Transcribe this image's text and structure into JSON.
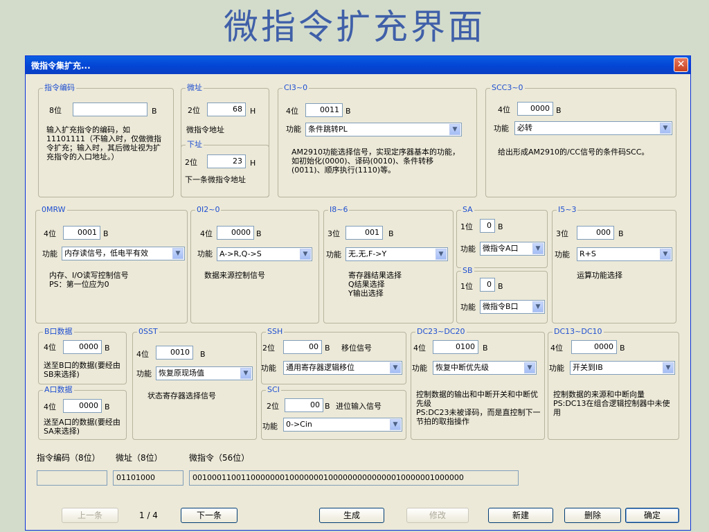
{
  "slide_title": "微指令扩充界面",
  "window": {
    "title": "微指令集扩充...",
    "close_glyph": "✕"
  },
  "groups": {
    "code": {
      "label": "指令编码",
      "prefix": "8位",
      "value": "",
      "unit": "B",
      "desc": "输入扩充指令的编码，如11101111（不输入时，仅做微指令扩充；输入时，其后微址视为扩充指令的入口地址。）"
    },
    "addr": {
      "label": "微址",
      "prefix": "2位",
      "value": "68",
      "unit": "H",
      "desc": "微指令地址"
    },
    "next": {
      "label": "下址",
      "prefix": "2位",
      "value": "23",
      "unit": "H",
      "desc": "下一条微指令地址"
    },
    "ci": {
      "label": "CI3~0",
      "prefix": "4位",
      "value": "0011",
      "unit": "B",
      "func_label": "功能",
      "func_value": "条件跳转PL",
      "desc": "AM2910功能选择信号，实现定序器基本的功能，如初始化(0000)、译码(0010)、条件转移(0011)、顺序执行(1110)等。"
    },
    "scc": {
      "label": "SCC3~0",
      "prefix": "4位",
      "value": "0000",
      "unit": "B",
      "func_label": "功能",
      "func_value": "必转",
      "desc": "给出形成AM2910的/CC信号的条件码SCC。"
    },
    "omrw": {
      "label": "0MRW",
      "prefix": "4位",
      "value": "0001",
      "unit": "B",
      "func_label": "功能",
      "func_value": "内存读信号，低电平有效",
      "desc": "内存、I/O读写控制信号\nPS：第一位应为0"
    },
    "oi2": {
      "label": "0I2~0",
      "prefix": "4位",
      "value": "0000",
      "unit": "B",
      "func_label": "功能",
      "func_value": "A->R,Q->S",
      "desc": "数据来源控制信号"
    },
    "i8": {
      "label": "I8~6",
      "prefix": "3位",
      "value": "001",
      "unit": "B",
      "func_label": "功能",
      "func_value": "无,无,F->Y",
      "desc": "寄存器结果选择\nQ结果选择\nY输出选择"
    },
    "sa": {
      "label": "SA",
      "prefix": "1位",
      "value": "0",
      "unit": "B",
      "func_label": "功能",
      "func_value": "微指令A口"
    },
    "sb": {
      "label": "SB",
      "prefix": "1位",
      "value": "0",
      "unit": "B",
      "func_label": "功能",
      "func_value": "微指令B口"
    },
    "i5": {
      "label": "I5~3",
      "prefix": "3位",
      "value": "000",
      "unit": "B",
      "func_label": "功能",
      "func_value": "R+S",
      "desc": "运算功能选择"
    },
    "bport": {
      "label": "B口数据",
      "prefix": "4位",
      "value": "0000",
      "unit": "B",
      "desc": "送至B口的数据(要经由SB来选择)"
    },
    "aport": {
      "label": "A口数据",
      "prefix": "4位",
      "value": "0000",
      "unit": "B",
      "desc": "送至A口的数据(要经由SA来选择)"
    },
    "osst": {
      "label": "0SST",
      "prefix": "4位",
      "value": "0010",
      "unit": "B",
      "func_label": "功能",
      "func_value": "恢复原现场值",
      "desc": "状态寄存器选择信号"
    },
    "ssh": {
      "label": "SSH",
      "prefix": "2位",
      "value": "00",
      "unit": "B",
      "extra": "移位信号",
      "func_label": "功能",
      "func_value": "通用寄存器逻辑移位"
    },
    "sci": {
      "label": "SCI",
      "prefix": "2位",
      "value": "00",
      "unit": "B",
      "extra": "进位输入信号",
      "func_label": "功能",
      "func_value": "0->Cin"
    },
    "dc23": {
      "label": "DC23~DC20",
      "prefix": "4位",
      "value": "0100",
      "unit": "B",
      "func_label": "功能",
      "func_value": "恢复中断优先级",
      "desc": "控制数据的输出和中断开关和中断优先级\nPS:DC23未被译码，而是直控制下一节拍的取指操作"
    },
    "dc13": {
      "label": "DC13~DC10",
      "prefix": "4位",
      "value": "0000",
      "unit": "B",
      "func_label": "功能",
      "func_value": "开关到IB",
      "desc": "控制数据的来源和中断向量\nPS:DC13在组合逻辑控制器中未使用"
    }
  },
  "summary": {
    "code_label": "指令编码（8位）",
    "addr_label": "微址（8位）",
    "micro_label": "微指令（56位）",
    "code_value": "",
    "addr_value": "01101000",
    "micro_value": "00100011001100000001000000010000000000000010000001000000"
  },
  "buttons": {
    "prev": "上一条",
    "page": "1 / 4",
    "next": "下一条",
    "generate": "生成",
    "modify": "修改",
    "new": "新建",
    "delete": "删除",
    "ok": "确定"
  }
}
